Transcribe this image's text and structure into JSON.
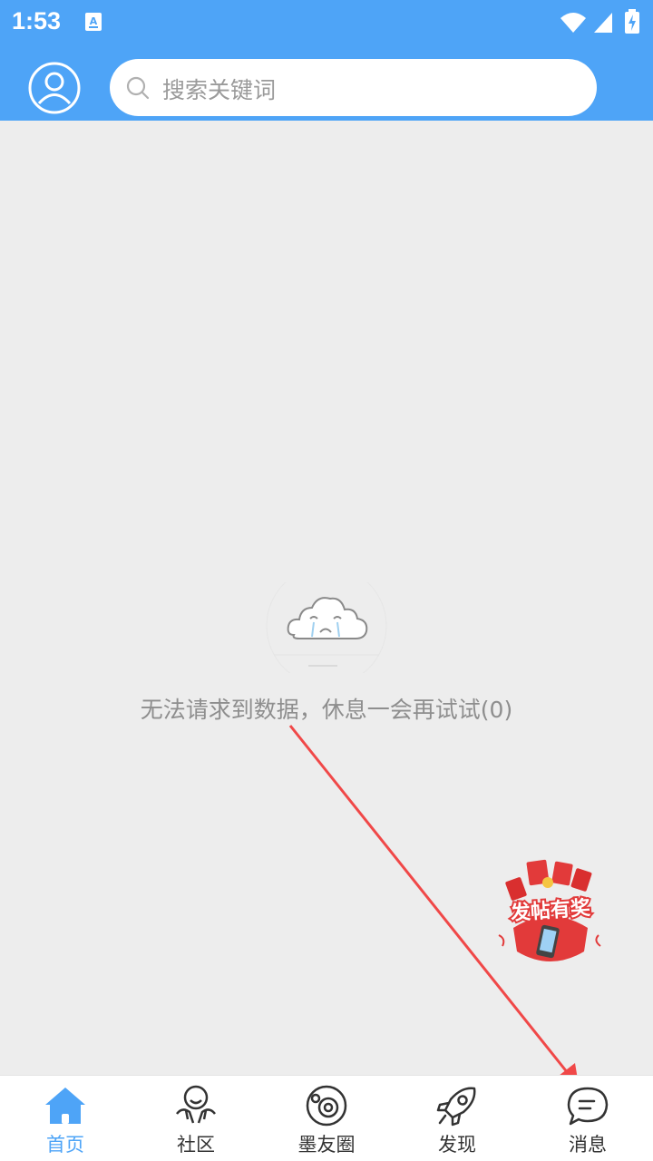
{
  "status_bar": {
    "time": "1:53"
  },
  "header": {
    "search_placeholder": "搜索关键词"
  },
  "empty_state": {
    "message": "无法请求到数据，休息一会再试试(0)"
  },
  "promo": {
    "text": "发帖有奖"
  },
  "tabs": [
    {
      "label": "首页",
      "icon": "home-icon",
      "active": true
    },
    {
      "label": "社区",
      "icon": "community-icon",
      "active": false
    },
    {
      "label": "墨友圈",
      "icon": "circle-icon",
      "active": false
    },
    {
      "label": "发现",
      "icon": "rocket-icon",
      "active": false
    },
    {
      "label": "消息",
      "icon": "message-icon",
      "active": false
    }
  ],
  "colors": {
    "primary": "#4ea4f7",
    "background": "#ededed",
    "annotation_arrow": "#f04848"
  }
}
